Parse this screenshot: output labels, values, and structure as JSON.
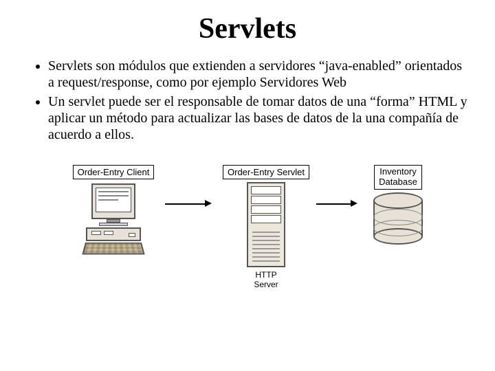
{
  "title": "Servlets",
  "bullets": [
    "Servlets son módulos que extienden a servidores “java-enabled” orientados a request/response, como por ejemplo Servidores Web",
    "Un servlet puede ser el responsable de tomar datos de una “forma” HTML y aplicar un método para actualizar las bases de datos de la una compañía de acuerdo a ellos."
  ],
  "diagram": {
    "client_label": "Order-Entry Client",
    "servlet_label": "Order-Entry Servlet",
    "server_caption": "HTTP\nServer",
    "db_label": "Inventory\nDatabase"
  }
}
